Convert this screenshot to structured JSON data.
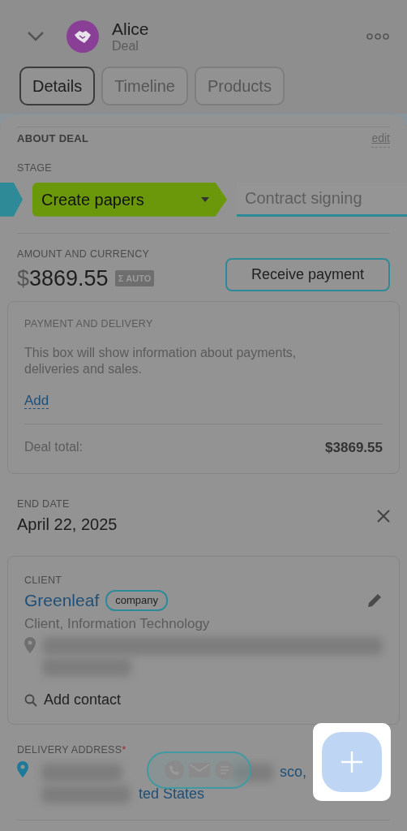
{
  "header": {
    "title": "Alice",
    "subtitle": "Deal"
  },
  "tabs": [
    {
      "label": "Details",
      "selected": true
    },
    {
      "label": "Timeline",
      "selected": false
    },
    {
      "label": "Products",
      "selected": false
    }
  ],
  "about": {
    "title": "ABOUT DEAL",
    "edit": "edit"
  },
  "stage": {
    "label": "STAGE",
    "steps": [
      {
        "kind": "past"
      },
      {
        "kind": "current",
        "label": "Create papers"
      },
      {
        "kind": "next",
        "label": "Contract signing"
      }
    ]
  },
  "amount": {
    "label": "AMOUNT AND CURRENCY",
    "currency": "$",
    "value": "3869.55",
    "badge": "Σ AUTO",
    "button": "Receive payment"
  },
  "payment": {
    "label": "PAYMENT AND DELIVERY",
    "text": "This box will show information about payments, deliveries and sales.",
    "add": "Add",
    "total_label": "Deal total:",
    "total": "$3869.55"
  },
  "end_date": {
    "label": "END DATE",
    "value": "April 22, 2025"
  },
  "client": {
    "label": "CLIENT",
    "name": "Greenleaf",
    "tag": "company",
    "description": "Client, Information Technology",
    "add_contact": "Add contact"
  },
  "delivery": {
    "label": "DELIVERY ADDRESS",
    "required_mark": "*",
    "fragments": [
      "sco,",
      "ted States"
    ]
  }
}
